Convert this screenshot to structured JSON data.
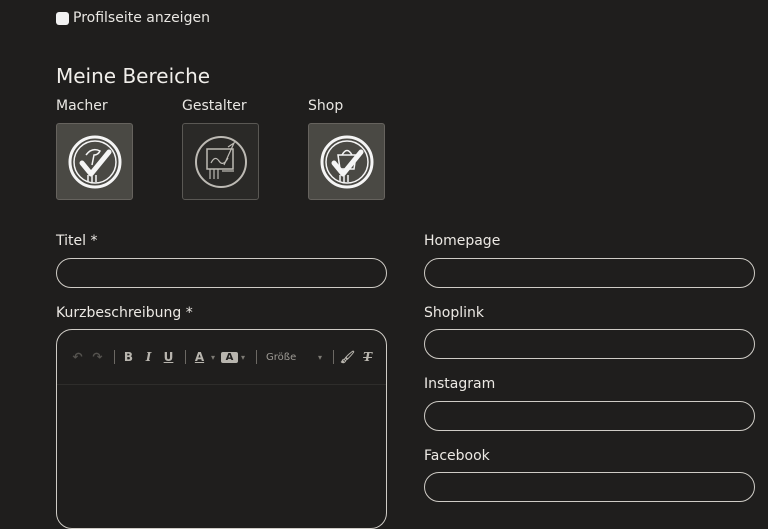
{
  "profile_checkbox": {
    "label": "Profilseite anzeigen",
    "checked": false
  },
  "areas": {
    "title": "Meine Bereiche",
    "items": [
      {
        "label": "Macher",
        "icon": "maker-check-icon",
        "selected": true
      },
      {
        "label": "Gestalter",
        "icon": "designer-icon",
        "selected": false
      },
      {
        "label": "Shop",
        "icon": "shop-check-icon",
        "selected": true
      }
    ]
  },
  "form": {
    "title_label": "Titel *",
    "title_value": "",
    "description_label": "Kurzbeschreibung *",
    "homepage_label": "Homepage",
    "shoplink_label": "Shoplink",
    "instagram_label": "Instagram",
    "facebook_label": "Facebook"
  },
  "editor_toolbar": {
    "bold": "B",
    "italic": "I",
    "underline": "U",
    "font_color": "A",
    "bg_color": "A",
    "size_label": "Größe",
    "clear_format": "T"
  },
  "colors": {
    "background": "#1f1e1d",
    "text": "#e9e7e3",
    "border": "#cfccc6"
  }
}
